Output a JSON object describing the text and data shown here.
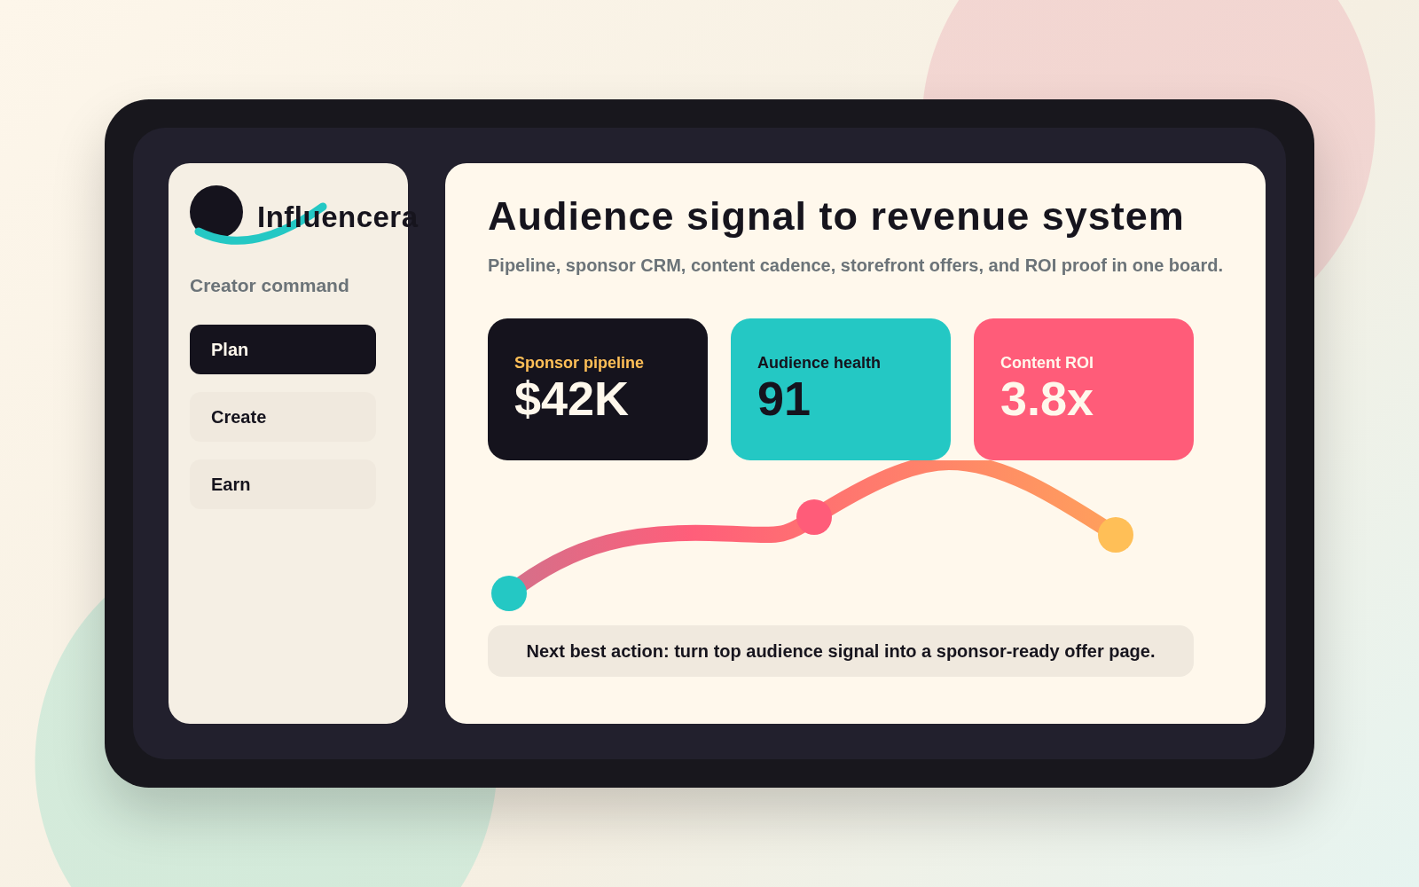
{
  "brand": {
    "name": "Influencera"
  },
  "sidebar": {
    "section_label": "Creator command",
    "items": [
      {
        "label": "Plan",
        "selected": true
      },
      {
        "label": "Create",
        "selected": false
      },
      {
        "label": "Earn",
        "selected": false
      }
    ]
  },
  "main": {
    "title": "Audience signal to revenue system",
    "subtitle": "Pipeline, sponsor CRM, content cadence, storefront offers, and ROI proof in one board.",
    "metrics": [
      {
        "kind": "dark",
        "label": "Sponsor pipeline",
        "value": "$42K"
      },
      {
        "kind": "teal",
        "label": "Audience health",
        "value": "91"
      },
      {
        "kind": "coral",
        "label": "Content ROI",
        "value": "3.8x"
      }
    ],
    "next_action": "Next best action: turn top audience signal into a sponsor-ready offer page."
  }
}
